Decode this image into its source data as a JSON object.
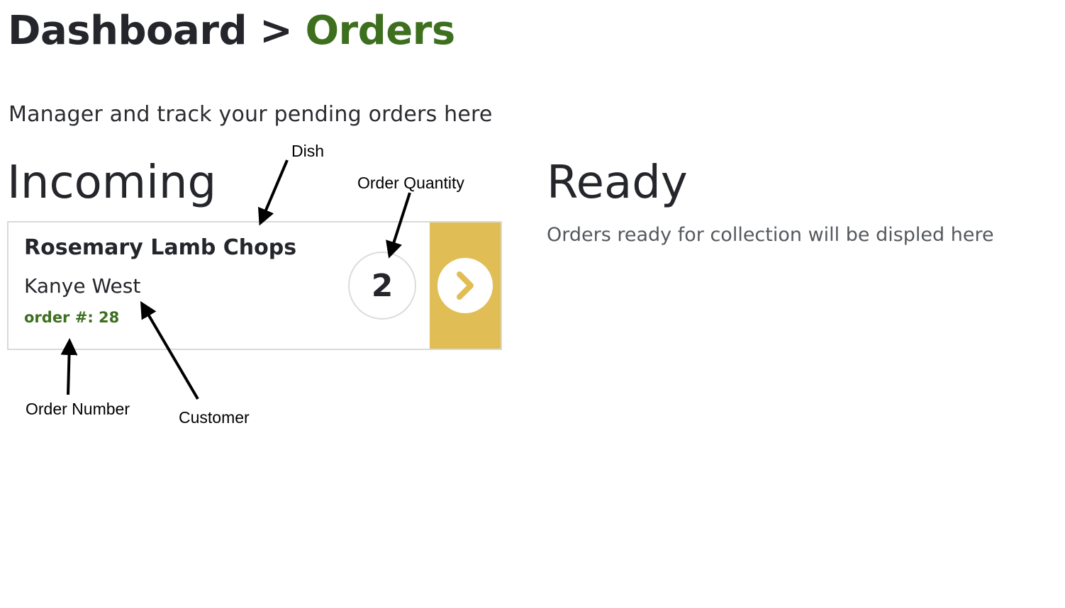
{
  "breadcrumb": {
    "home": "Dashboard",
    "separator": ">",
    "current": "Orders"
  },
  "subtitle": "Manager and track your pending orders here",
  "incoming": {
    "heading": "Incoming",
    "orders": [
      {
        "dish": "Rosemary Lamb Chops",
        "customer": "Kanye West",
        "order_number_label": "order #: 28",
        "quantity": "2",
        "advance_icon": "chevron-right-icon"
      }
    ]
  },
  "ready": {
    "heading": "Ready",
    "empty_message": "Orders ready for collection will be displed here"
  },
  "annotations": {
    "dish": "Dish",
    "order_quantity": "Order Quantity",
    "order_number": "Order Number",
    "customer": "Customer"
  },
  "colors": {
    "accent_green": "#3d6f1f",
    "advance_panel": "#e0be55",
    "text_dark": "#24262b",
    "card_border": "#d9d9d9"
  }
}
